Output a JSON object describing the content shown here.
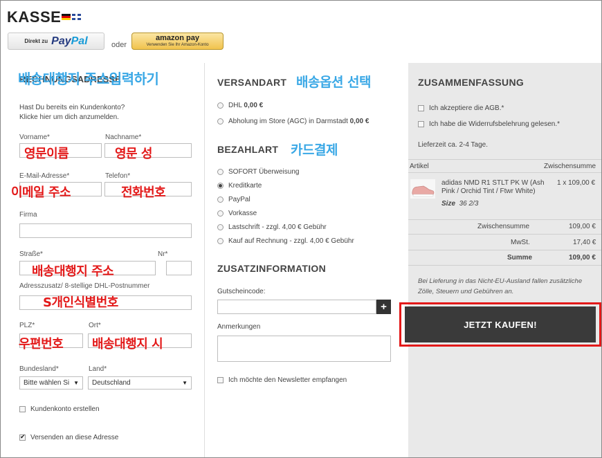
{
  "header": {
    "title": "KASSE",
    "paypal_small": "Direkt zu",
    "paypal_brand_a": "Pay",
    "paypal_brand_b": "Pal",
    "or_text": "oder",
    "amazon_brand": "amazon pay",
    "amazon_sub": "Verwenden Sie Ihr Amazon-Konto"
  },
  "address": {
    "section_title_partial": "RECHNUNGSADRESSE",
    "overlay_title": "배송대행지 주소입력하기",
    "login_hint_1": "Hast Du bereits ein Kundenkonto?",
    "login_hint_2": "Klicke hier um dich anzumelden.",
    "firstname_label": "Vorname*",
    "lastname_label": "Nachname*",
    "firstname_note": "영문이름",
    "lastname_note": "영문 성",
    "email_label": "E-Mail-Adresse*",
    "phone_label": "Telefon*",
    "email_note": "이메일 주소",
    "phone_note": "전화번호",
    "company_label": "Firma",
    "street_label": "Straße*",
    "nr_label": "Nr*",
    "street_note": "배송대행지 주소",
    "addr2_label": "Adresszusatz/ 8-stellige DHL-Postnummer",
    "addr2_note": "S개인식별번호",
    "zip_label": "PLZ*",
    "city_label": "Ort*",
    "zip_note": "우편번호",
    "city_note": "배송대행지 시",
    "state_label": "Bundesland*",
    "country_label": "Land*",
    "state_value": "Bitte wählen Si",
    "country_value": "Deutschland",
    "create_account": "Kundenkonto erstellen",
    "ship_here": "Versenden an diese Adresse"
  },
  "shipping": {
    "title": "VERSANDART",
    "overlay": "배송옵션 선택",
    "options": [
      {
        "label": "DHL",
        "price": "0,00 €"
      },
      {
        "label": "Abholung im Store (AGC) in Darmstadt",
        "price": "0,00 €"
      }
    ]
  },
  "payment": {
    "title": "BEZAHLART",
    "overlay": "카드결제",
    "options": [
      "SOFORT Überweisung",
      "Kreditkarte",
      "PayPal",
      "Vorkasse",
      "Lastschrift - zzgl. 4,00 € Gebühr",
      "Kauf auf Rechnung - zzgl. 4,00 € Gebühr"
    ]
  },
  "extra": {
    "title": "ZUSATZINFORMATION",
    "coupon_label": "Gutscheincode:",
    "plus": "+",
    "notes_label": "Anmerkungen",
    "newsletter": "Ich möchte den Newsletter empfangen"
  },
  "summary": {
    "title": "ZUSAMMENFASSUNG",
    "agb": "Ich akzeptiere die AGB.*",
    "widerruf": "Ich habe die Widerrufsbelehrung gelesen.*",
    "delivery": "Lieferzeit ca. 2-4 Tage.",
    "col_article": "Artikel",
    "col_subtotal": "Zwischensumme",
    "item_name": "adidas NMD R1 STLT PK W (Ash Pink / Orchid Tint / Ftwr White)",
    "item_qty_price": "1 x 109,00 €",
    "size_label": "Size",
    "size_value": "36 2/3",
    "subtotal_label": "Zwischensumme",
    "subtotal_value": "109,00 €",
    "tax_label": "MwSt.",
    "tax_value": "17,40 €",
    "total_label": "Summe",
    "total_value": "109,00 €",
    "notice": "Bei Lieferung in das Nicht-EU-Ausland fallen zusätzliche Zölle, Steuern und Gebühren an.",
    "buy_label": "JETZT KAUFEN!"
  },
  "colors": {
    "annotation_red": "#e31919",
    "annotation_blue": "#3aa8e6",
    "buy_button": "#3a3a3a"
  }
}
